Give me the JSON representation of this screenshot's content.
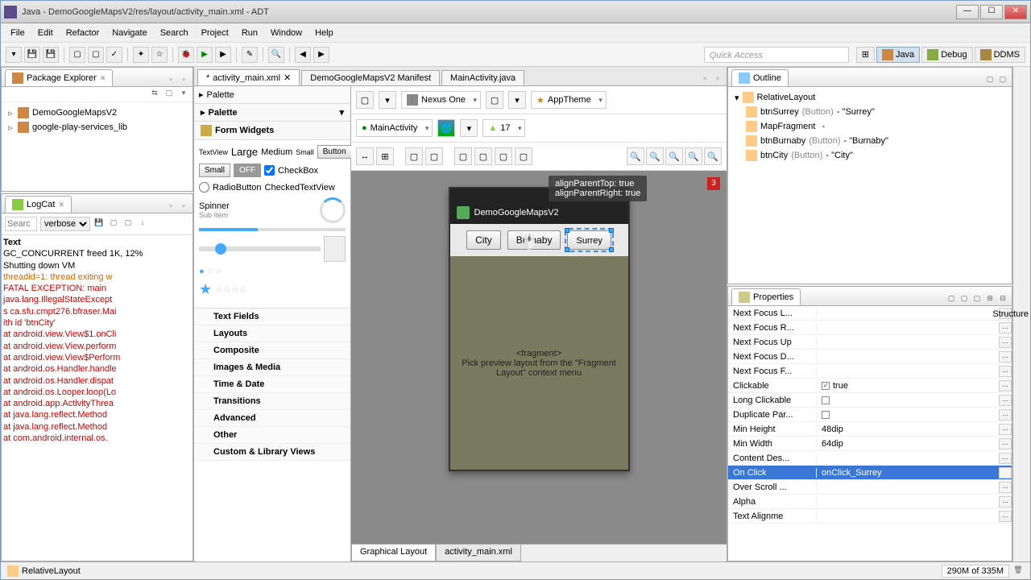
{
  "window": {
    "title": "Java - DemoGoogleMapsV2/res/layout/activity_main.xml - ADT"
  },
  "menu": [
    "File",
    "Edit",
    "Refactor",
    "Navigate",
    "Search",
    "Project",
    "Run",
    "Window",
    "Help"
  ],
  "quickaccess_placeholder": "Quick Access",
  "perspectives": {
    "java": "Java",
    "debug": "Debug",
    "ddms": "DDMS"
  },
  "packageExplorer": {
    "title": "Package Explorer",
    "items": [
      "DemoGoogleMapsV2",
      "google-play-services_lib"
    ]
  },
  "logcat": {
    "title": "LogCat",
    "search_placeholder": "Searc",
    "level": "verbose",
    "header": "Text",
    "lines": [
      {
        "cls": "",
        "t": "GC_CONCURRENT freed 1K, 12%"
      },
      {
        "cls": "",
        "t": "Shutting down VM"
      },
      {
        "cls": "warn",
        "t": "threadid=1: thread exiting w"
      },
      {
        "cls": "err",
        "t": "FATAL EXCEPTION: main"
      },
      {
        "cls": "err",
        "t": "java.lang.IllegalStateExcept"
      },
      {
        "cls": "err",
        "t": "s ca.sfu.cmpt276.bfraser.Mai"
      },
      {
        "cls": "err",
        "t": "ith id 'btnCity'"
      },
      {
        "cls": "err",
        "t": "at android.view.View$1.onCli"
      },
      {
        "cls": "err",
        "t": "at android.view.View.perform"
      },
      {
        "cls": "err",
        "t": "at android.view.View$Perform"
      },
      {
        "cls": "err",
        "t": "at android.os.Handler.handle"
      },
      {
        "cls": "err",
        "t": "at android.os.Handler.dispat"
      },
      {
        "cls": "err",
        "t": "at android.os.Looper.loop(Lo"
      },
      {
        "cls": "err",
        "t": "at android.app.ActivityThrea"
      },
      {
        "cls": "err",
        "t": "at java.lang.reflect.Method"
      },
      {
        "cls": "err",
        "t": "at java.lang.reflect.Method"
      },
      {
        "cls": "err",
        "t": "at com.android.internal.os."
      }
    ]
  },
  "editorTabs": [
    {
      "label": "activity_main.xml",
      "dirty": true,
      "active": true
    },
    {
      "label": "DemoGoogleMapsV2 Manifest",
      "dirty": false,
      "active": false
    },
    {
      "label": "MainActivity.java",
      "dirty": false,
      "active": false
    }
  ],
  "palette": {
    "title": "Palette",
    "section": "Palette",
    "formWidgets": "Form Widgets",
    "textview": "TextView",
    "large": "Large",
    "medium": "Medium",
    "small": "Small",
    "button": "Button",
    "smallbtn": "Small",
    "off": "OFF",
    "checkbox": "CheckBox",
    "radio": "RadioButton",
    "checkedtext": "CheckedTextView",
    "spinner": "Spinner",
    "subitem": "Sub Item",
    "categories": [
      "Text Fields",
      "Layouts",
      "Composite",
      "Images & Media",
      "Time & Date",
      "Transitions",
      "Advanced",
      "Other",
      "Custom & Library Views"
    ]
  },
  "previewToolbar": {
    "device": "Nexus One",
    "theme": "AppTheme",
    "activity": "MainActivity",
    "api": "17"
  },
  "devicePreview": {
    "appTitle": "DemoGoogleMapsV2",
    "btnCity": "City",
    "btnBurnaby": "Burnaby",
    "btnSurrey": "Surrey",
    "fragment": "<fragment>",
    "fragmentHint": "Pick preview layout from the \"Fragment Layout\" context menu",
    "tooltip1": "alignParentTop: true",
    "tooltip2": "alignParentRight: true",
    "errors": "3"
  },
  "bottomTabs": {
    "graphical": "Graphical Layout",
    "xml": "activity_main.xml"
  },
  "structure": {
    "label": "Structure"
  },
  "outline": {
    "title": "Outline",
    "root": "RelativeLayout",
    "items": [
      {
        "id": "btnSurrey",
        "type": "(Button)",
        "text": "\"Surrey\""
      },
      {
        "id": "MapFragment",
        "type": "",
        "text": ""
      },
      {
        "id": "btnBurnaby",
        "type": "(Button)",
        "text": "\"Burnaby\""
      },
      {
        "id": "btnCity",
        "type": "(Button)",
        "text": "\"City\""
      }
    ]
  },
  "properties": {
    "title": "Properties",
    "rows": [
      {
        "name": "Next Focus L...",
        "val": ""
      },
      {
        "name": "Next Focus R...",
        "val": ""
      },
      {
        "name": "Next Focus Up",
        "val": ""
      },
      {
        "name": "Next Focus D...",
        "val": ""
      },
      {
        "name": "Next Focus F...",
        "val": ""
      },
      {
        "name": "Clickable",
        "val": "true",
        "check": true
      },
      {
        "name": "Long Clickable",
        "val": "",
        "check": true
      },
      {
        "name": "Duplicate Par...",
        "val": "",
        "check": true
      },
      {
        "name": "Min Height",
        "val": "48dip"
      },
      {
        "name": "Min Width",
        "val": "64dip"
      },
      {
        "name": "Content Des...",
        "val": ""
      },
      {
        "name": "On Click",
        "val": "onClick_Surrey",
        "sel": true
      },
      {
        "name": "Over Scroll ...",
        "val": ""
      },
      {
        "name": "Alpha",
        "val": ""
      },
      {
        "name": "Text Alignme",
        "val": ""
      }
    ]
  },
  "status": {
    "element": "RelativeLayout",
    "heap": "290M of 335M"
  }
}
